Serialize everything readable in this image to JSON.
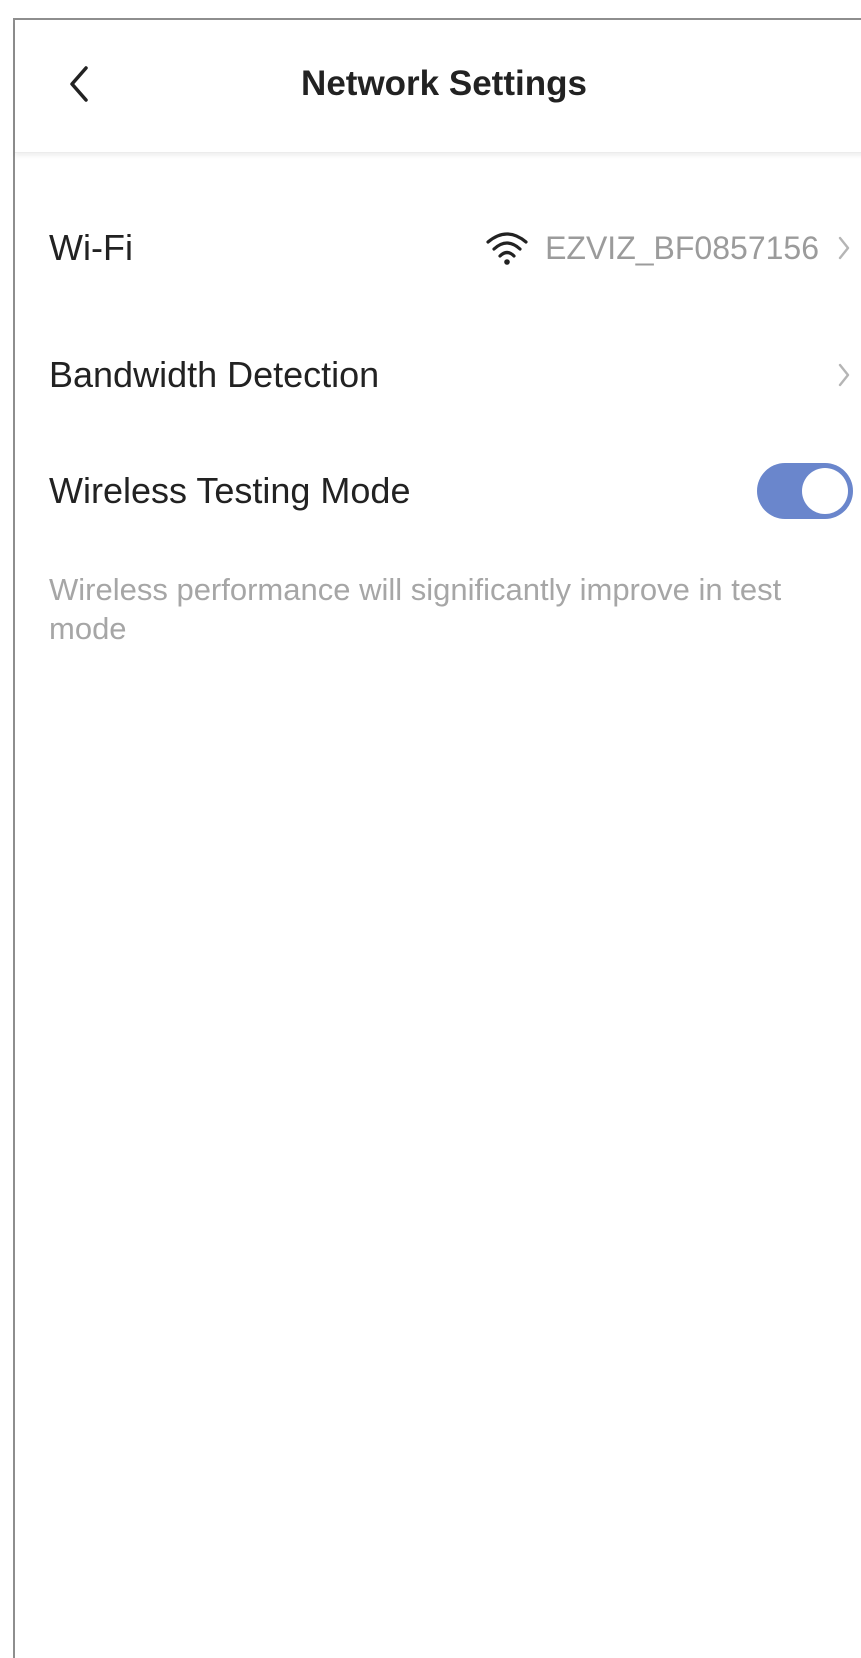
{
  "header": {
    "title": "Network Settings",
    "back_icon": "chevron-left-icon"
  },
  "settings": {
    "wifi": {
      "label": "Wi-Fi",
      "value": "EZVIZ_BF0857156",
      "icon": "wifi-icon"
    },
    "bandwidth": {
      "label": "Bandwidth Detection"
    },
    "wireless_testing": {
      "label": "Wireless Testing Mode",
      "enabled": true,
      "description": "Wireless performance will significantly improve in test mode"
    }
  },
  "colors": {
    "toggle_on": "#6a86cc",
    "text_primary": "#222222",
    "text_secondary": "#9b9b9b"
  }
}
